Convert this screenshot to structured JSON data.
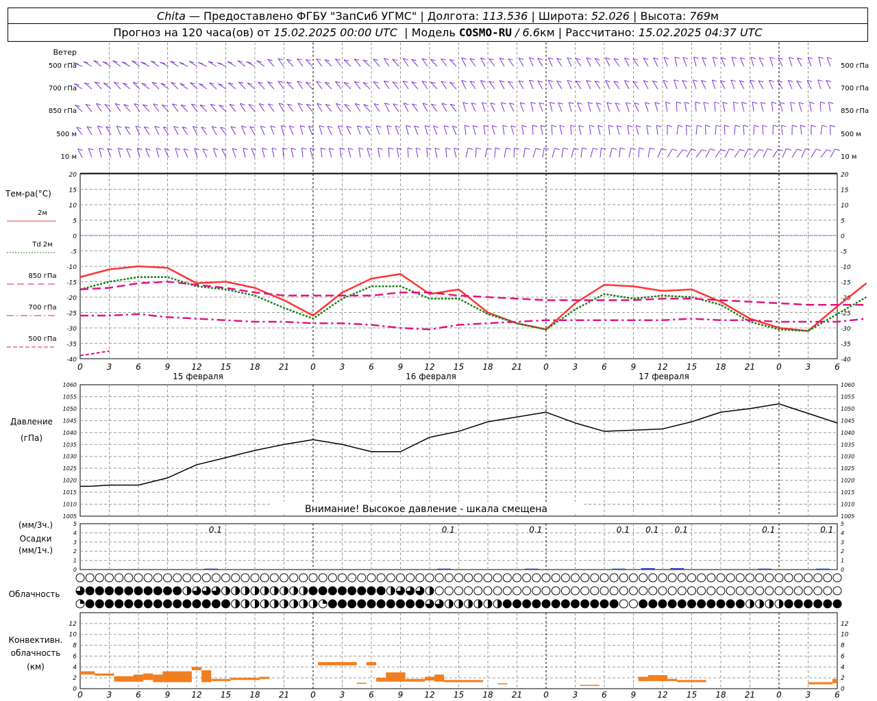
{
  "header": {
    "station": "Chita",
    "provider": "— Предоставлено ФГБУ \"ЗапСиб УГМС\"",
    "lon_label": "Долгота:",
    "lon_value": "113.536",
    "lat_label": "Широта:",
    "lat_value": "52.026",
    "alt_label": "Высота:",
    "alt_value": "769",
    "alt_unit": "м",
    "forecast_label": "Прогноз на 120 часа(ов) от",
    "forecast_start": "15.02.2025 00:00 UTC",
    "model_label": "Модель",
    "model_name": "COSMO-RU",
    "model_res": "/ 6.6",
    "model_res_unit": "км",
    "calc_label": "Рассчитано:",
    "calc_time": "15.02.2025 04:37 UTC"
  },
  "wind": {
    "title": "Ветер",
    "levels": [
      "500 гПа",
      "700 гПа",
      "850 гПа",
      "500 м",
      "10 м"
    ],
    "color": "#7a2fd0"
  },
  "temperature": {
    "title": "Тем-ра(°С)",
    "legend": [
      {
        "label": "2м",
        "color": "#ff3333",
        "style": "solid"
      },
      {
        "label": "Td  2м",
        "color": "#1a7f1a",
        "style": "dotted"
      },
      {
        "label": "850 гПа",
        "color": "#e0147f",
        "style": "dash"
      },
      {
        "label": "700 гПа",
        "color": "#e0147f",
        "style": "dashdot"
      },
      {
        "label": "500 гПа",
        "color": "#e0147f",
        "style": "dash-thin"
      }
    ],
    "ylim": [
      -40,
      20
    ],
    "ticks": [
      20,
      15,
      10,
      5,
      0,
      -5,
      -10,
      -15,
      -20,
      -25,
      -30,
      -35,
      -40
    ]
  },
  "time_axis": {
    "hour_labels": [
      "0",
      "3",
      "6",
      "9",
      "12",
      "15",
      "18",
      "21",
      "0",
      "3",
      "6",
      "9",
      "12",
      "15",
      "18",
      "21",
      "0",
      "3",
      "6",
      "9",
      "12",
      "15",
      "18",
      "21",
      "0",
      "3",
      "6"
    ],
    "dates": [
      "15 февраля",
      "16 февраля",
      "17 февраля"
    ]
  },
  "pressure": {
    "title": "Давление",
    "unit": "(гПа)",
    "warning": "Внимание! Высокое давление - шкала смещена",
    "ylim": [
      1005,
      1060
    ],
    "ticks": [
      1060,
      1055,
      1050,
      1045,
      1040,
      1035,
      1030,
      1025,
      1020,
      1015,
      1010,
      1005
    ]
  },
  "precip": {
    "unit_top": "(мм/3ч.)",
    "title": "Осадки",
    "unit_bottom": "(мм/1ч.)",
    "ylim": [
      0,
      5
    ],
    "ticks": [
      5,
      4,
      3,
      2,
      1,
      0
    ],
    "labels": [
      {
        "hour": 14,
        "text": "0.1"
      },
      {
        "hour": 38,
        "text": "0.1"
      },
      {
        "hour": 47,
        "text": "0.1"
      },
      {
        "hour": 56,
        "text": "0.1"
      },
      {
        "hour": 59,
        "text": "0.1"
      },
      {
        "hour": 62,
        "text": "0.1"
      },
      {
        "hour": 71,
        "text": "0.1"
      },
      {
        "hour": 77,
        "text": "0.1"
      }
    ]
  },
  "clouds": {
    "title": "Облачность"
  },
  "convective": {
    "title1": "Конвективн.",
    "title2": "облачность",
    "unit": "(км)",
    "ylim": [
      0,
      14
    ],
    "ticks": [
      12,
      10,
      8,
      6,
      4,
      2,
      0
    ],
    "color": "#f07f20"
  },
  "chart_data": [
    {
      "type": "line",
      "title": "Тем-ра(°С)",
      "x_hours": [
        0,
        3,
        6,
        9,
        12,
        15,
        18,
        21,
        24,
        27,
        30,
        33,
        36,
        39,
        42,
        45,
        48,
        51,
        54,
        57,
        60,
        63,
        66,
        69,
        72,
        75,
        78
      ],
      "series": [
        {
          "name": "2м",
          "values": [
            -13.5,
            -11,
            -10,
            -10.5,
            -15.5,
            -15,
            -17,
            -21,
            -26,
            -18.5,
            -14,
            -12.5,
            -19,
            -17.5,
            -25,
            -28.5,
            -30.5,
            -22,
            -16,
            -16.5,
            -18,
            -17.5,
            -21.5,
            -27,
            -30,
            -31,
            -23,
            -15.5
          ]
        },
        {
          "name": "Td  2м",
          "values": [
            -17.5,
            -15,
            -13.5,
            -13.5,
            -16.5,
            -17.5,
            -19.5,
            -23.5,
            -27,
            -20.5,
            -16.5,
            -16.5,
            -20.5,
            -20.5,
            -25.5,
            -28.5,
            -30.5,
            -24,
            -19,
            -20.5,
            -19.5,
            -20,
            -22.5,
            -28,
            -30.5,
            -31,
            -25.5,
            -20
          ]
        },
        {
          "name": "850 гПа",
          "values": [
            -17.5,
            -17,
            -15.5,
            -15,
            -16,
            -17,
            -18.5,
            -19.5,
            -19.5,
            -19.5,
            -19.5,
            -18.5,
            -18.5,
            -19.5,
            -20,
            -20.5,
            -21,
            -21,
            -21,
            -21,
            -20.5,
            -20.5,
            -21,
            -21.5,
            -22,
            -22.5,
            -22.5,
            -22.5
          ]
        },
        {
          "name": "700 гПа",
          "values": [
            -26,
            -26,
            -25.5,
            -26.5,
            -27,
            -27.5,
            -28,
            -28,
            -28.5,
            -28.5,
            -29,
            -30,
            -30.5,
            -29,
            -28.5,
            -28,
            -27.5,
            -27.5,
            -27.5,
            -27.5,
            -27.5,
            -27,
            -27.5,
            -27.5,
            -28,
            -28,
            -28,
            -27
          ]
        },
        {
          "name": "500 гПа",
          "values": [
            -39,
            -37.5
          ]
        }
      ],
      "ylim": [
        -40,
        20
      ]
    },
    {
      "type": "line",
      "title": "Давление",
      "x_hours": [
        0,
        1,
        3,
        6,
        9,
        12,
        15,
        18,
        21,
        24,
        27,
        30,
        33,
        36,
        39,
        42,
        45,
        48,
        51,
        54,
        57,
        60,
        63,
        66,
        69,
        72,
        75,
        78
      ],
      "series": [
        {
          "name": "Давление",
          "values": [
            1017.5,
            1017.5,
            1018,
            1018,
            1021,
            1026.5,
            1029.5,
            1032.5,
            1035,
            1037,
            1035,
            1032,
            1032,
            1038,
            1040.5,
            1044.5,
            1046.5,
            1048.5,
            1044,
            1040.5,
            1041,
            1041.5,
            1044.5,
            1048.5,
            1050,
            1052,
            1048,
            1044
          ]
        }
      ],
      "ylim": [
        1005,
        1060
      ]
    },
    {
      "type": "bar",
      "title": "Конвективн. облачность",
      "bars": [
        {
          "start": 0,
          "end": 1.5,
          "base": 2.6,
          "top": 3.2
        },
        {
          "start": 1.5,
          "end": 3.5,
          "base": 2.4,
          "top": 2.8
        },
        {
          "start": 3.5,
          "end": 5.5,
          "base": 1.3,
          "top": 2.3
        },
        {
          "start": 5.5,
          "end": 6.5,
          "base": 1.3,
          "top": 2.6
        },
        {
          "start": 6.5,
          "end": 7.5,
          "base": 1.6,
          "top": 2.8
        },
        {
          "start": 7.5,
          "end": 8.5,
          "base": 1.2,
          "top": 2.6
        },
        {
          "start": 8.5,
          "end": 11.5,
          "base": 1.2,
          "top": 3.2
        },
        {
          "start": 11.5,
          "end": 12.5,
          "base": 3.4,
          "top": 4.0
        },
        {
          "start": 12.5,
          "end": 13.5,
          "base": 1.2,
          "top": 3.4
        },
        {
          "start": 13.5,
          "end": 15.5,
          "base": 1.4,
          "top": 1.8
        },
        {
          "start": 15.5,
          "end": 18.5,
          "base": 1.6,
          "top": 2.0
        },
        {
          "start": 18.5,
          "end": 19.5,
          "base": 1.8,
          "top": 2.2
        },
        {
          "start": 24.5,
          "end": 28.5,
          "base": 4.3,
          "top": 4.9
        },
        {
          "start": 29.5,
          "end": 30.5,
          "base": 4.3,
          "top": 4.9
        },
        {
          "start": 28.5,
          "end": 29.5,
          "base": 0.9,
          "top": 1.1
        },
        {
          "start": 30.5,
          "end": 31.5,
          "base": 1.3,
          "top": 2.0
        },
        {
          "start": 31.5,
          "end": 33.5,
          "base": 1.3,
          "top": 3.0
        },
        {
          "start": 33.5,
          "end": 35.5,
          "base": 1.3,
          "top": 1.8
        },
        {
          "start": 35.5,
          "end": 36.5,
          "base": 1.5,
          "top": 2.2
        },
        {
          "start": 36.5,
          "end": 37.5,
          "base": 1.3,
          "top": 2.6
        },
        {
          "start": 37.5,
          "end": 41.5,
          "base": 1.2,
          "top": 1.6
        },
        {
          "start": 43,
          "end": 44,
          "base": 0.8,
          "top": 1.0
        },
        {
          "start": 51.5,
          "end": 53.5,
          "base": 0.5,
          "top": 0.7
        },
        {
          "start": 57.5,
          "end": 58.5,
          "base": 1.4,
          "top": 2.2
        },
        {
          "start": 58.5,
          "end": 60.5,
          "base": 1.4,
          "top": 2.5
        },
        {
          "start": 60.5,
          "end": 61.5,
          "base": 1.4,
          "top": 1.8
        },
        {
          "start": 61.5,
          "end": 64.5,
          "base": 1.2,
          "top": 1.6
        },
        {
          "start": 75,
          "end": 77.5,
          "base": 0.8,
          "top": 1.2
        },
        {
          "start": 77.5,
          "end": 78,
          "base": 1.0,
          "top": 1.8
        }
      ],
      "ylim": [
        0,
        14
      ]
    },
    {
      "type": "bar",
      "title": "Осадки",
      "bars": [
        {
          "hour": 13.5,
          "value": 0.1
        },
        {
          "hour": 37.5,
          "value": 0.1
        },
        {
          "hour": 46.5,
          "value": 0.1
        },
        {
          "hour": 55.5,
          "value": 0.1
        },
        {
          "hour": 58.5,
          "value": 0.15
        },
        {
          "hour": 61.5,
          "value": 0.15
        },
        {
          "hour": 70.5,
          "value": 0.1
        },
        {
          "hour": 76.5,
          "value": 0.1
        }
      ],
      "ylim": [
        0,
        5
      ]
    }
  ],
  "cloud_rows": {
    "top": "000000000000000000000000000000000000000000000000000000000000000000000000000000",
    "mid": "3444444444423332222222224444444423332000000000000000000000000000000000000000000",
    "low": "14444444444444442222222221444444444433222222444444444444004444444444422224444444444"
  }
}
